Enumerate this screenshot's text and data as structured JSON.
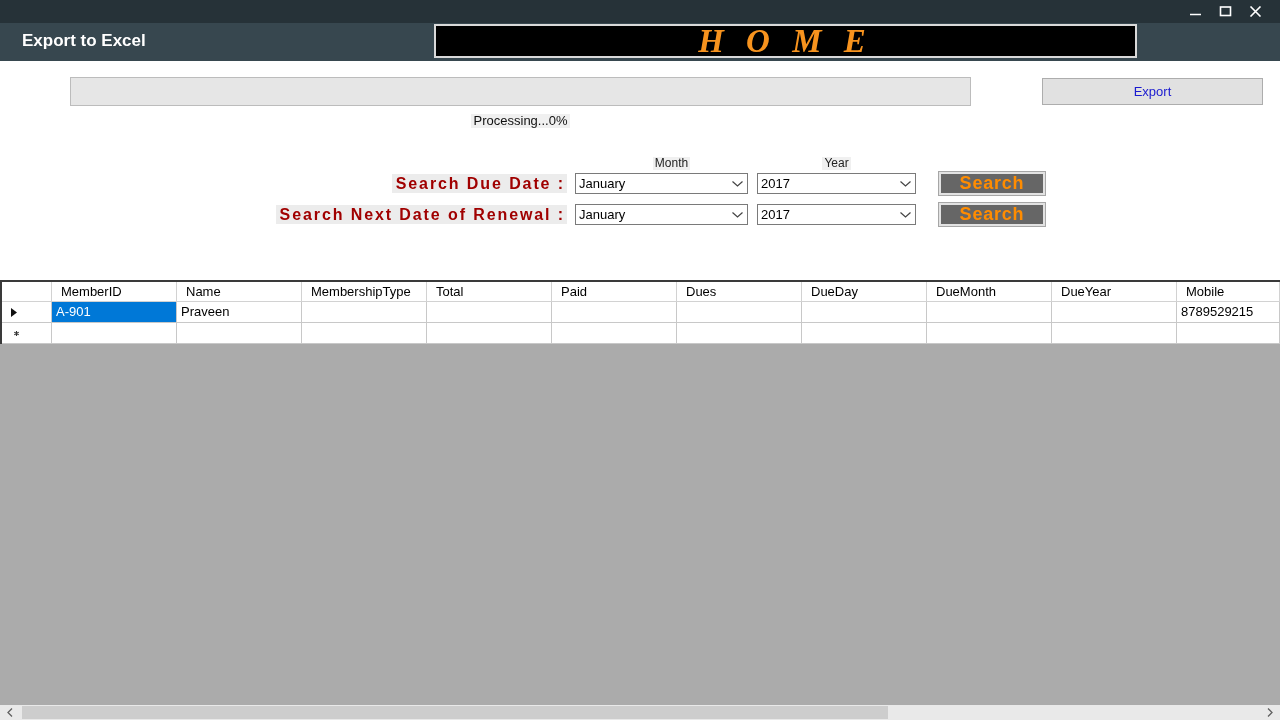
{
  "window": {
    "title": "Export to Excel",
    "banner": "H O M E"
  },
  "export": {
    "progress": {
      "level": 0,
      "status": "Processing...0%"
    },
    "button": "Export"
  },
  "search": {
    "headings": [
      "Month",
      "Year"
    ],
    "rows": [
      {
        "label": "Search Due Date :",
        "month": "January",
        "year": "2017",
        "button": "Search"
      },
      {
        "label": "Search Next Date of Renewal :",
        "month": "January",
        "year": "2017",
        "button": "Search"
      }
    ]
  },
  "table": {
    "columns": [
      "MemberID",
      "Name",
      "MembershipType",
      "Total",
      "Paid",
      "Dues",
      "DueDay",
      "DueMonth",
      "DueYear",
      "Mobile"
    ],
    "rows": [
      {
        "kind": "current",
        "cells": [
          {
            "text": "A-901",
            "selected": true
          },
          {
            "text": "Praveen",
            "selected": false
          },
          {
            "selected": false
          },
          {
            "selected": false
          },
          {
            "selected": false
          },
          {
            "selected": false
          },
          {
            "selected": false
          },
          {
            "selected": false
          },
          {
            "selected": false
          },
          {
            "text": "8789529215",
            "selected": false
          }
        ]
      },
      {
        "kind": "new",
        "cells": [
          {
            "selected": false
          },
          {
            "selected": false
          },
          {
            "selected": false
          },
          {
            "selected": false
          },
          {
            "selected": false
          },
          {
            "selected": false
          },
          {
            "selected": false
          },
          {
            "selected": false
          },
          {
            "selected": false
          },
          {
            "selected": false
          }
        ]
      }
    ]
  }
}
